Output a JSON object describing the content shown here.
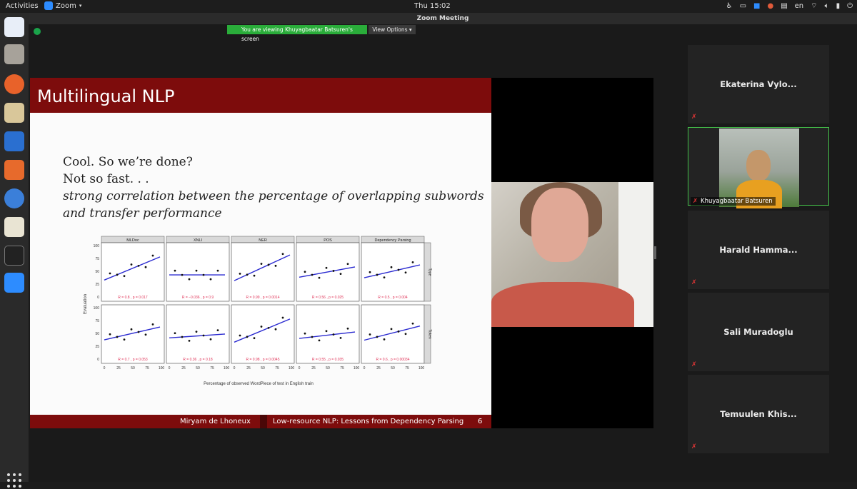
{
  "topbar": {
    "activities": "Activities",
    "app_name": "Zoom",
    "clock": "Thu 15:02",
    "language": "en"
  },
  "window": {
    "title": "Zoom Meeting",
    "viewing_banner": "You are viewing Khuyagbaatar Batsuren's screen",
    "view_options": "View Options"
  },
  "slide": {
    "title": "Multilingual NLP",
    "line1": "Cool. So we’re done?",
    "line2": "Not so fast. . .",
    "line3": "strong correlation between the percentage of overlapping subwords",
    "line4": "and transfer performance",
    "footer_author": "Miryam de Lhoneux",
    "footer_talk": "Low-resource NLP: Lessons from Dependency Parsing",
    "footer_page": "6"
  },
  "figure": {
    "ylabel": "Evaluation",
    "xlabel": "Percentage of observed WordPiece of test in English train",
    "panels": [
      "MLDoc",
      "XNLI",
      "NER",
      "POS",
      "Dependency Parsing"
    ],
    "rows": [
      "Type",
      "Token"
    ],
    "yticks": [
      "100",
      "75",
      "50",
      "25",
      "0"
    ],
    "xticks": [
      "0",
      "25",
      "50",
      "75",
      "100"
    ],
    "stats_type": [
      "R = 0.8 , p = 0.017",
      "R = −0.036 , p = 0.9",
      "R = 0.99 , p = 0.0014",
      "R = 0.56 , p = 0.025",
      "R = 0.5 , p = 0.004"
    ],
    "stats_token": [
      "R = 0.7 , p = 0.053",
      "R = 0.36 , p = 0.18",
      "R = 0.98 , p = 0.0045",
      "R = 0.55 , p = 0.035",
      "R = 0.6 , p = 0.00034"
    ]
  },
  "participants": [
    {
      "name": "Ekaterina Vylo...",
      "muted": true
    },
    {
      "name": "Khuyagbaatar Batsuren",
      "muted": true,
      "active": true
    },
    {
      "name": "Harald Hamma...",
      "muted": true
    },
    {
      "name": "Sali Muradoglu",
      "muted": true
    },
    {
      "name": "Temuulen Khis...",
      "muted": true
    }
  ],
  "colors": {
    "slide_header": "#7d0c0c",
    "banner_green": "#2aad3a",
    "active_border": "#44c14a",
    "muted_red": "#e03535",
    "regression_line": "#2a2ad0"
  }
}
